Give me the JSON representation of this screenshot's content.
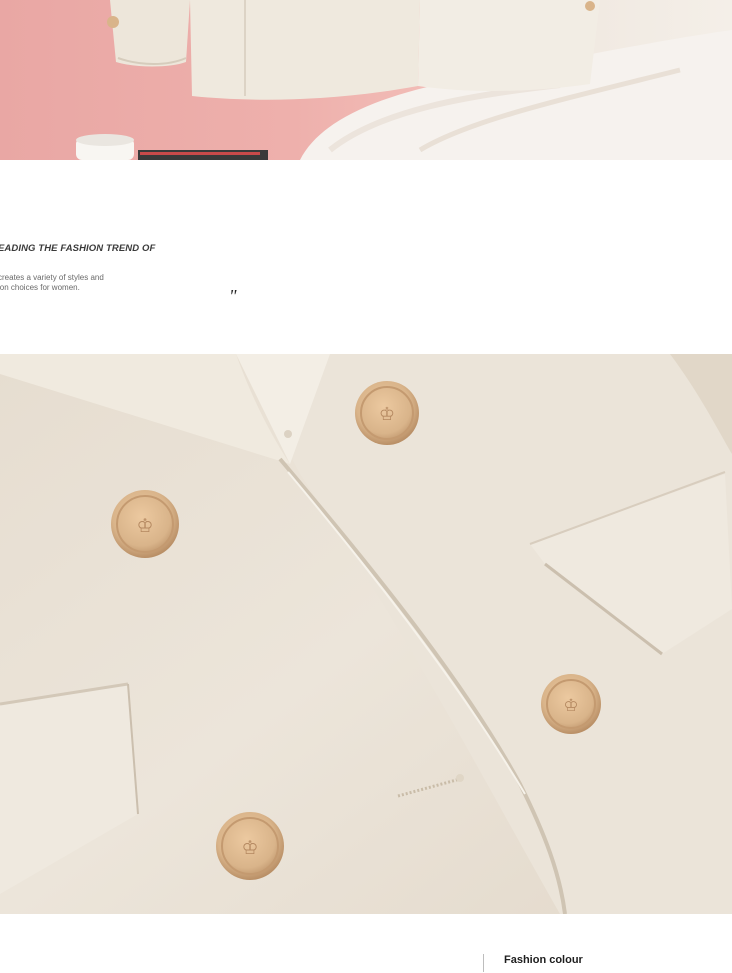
{
  "intro": {
    "heading": "EADING THE FASHION TREND OF",
    "desc_line1": "creates a variety of styles and",
    "desc_line2": "ion choices for women.",
    "quote_mark": "\""
  },
  "footer": {
    "section_title": "Fashion colour"
  },
  "colors": {
    "fabric": "#e9e1d5",
    "button_gold": "#d9b48a",
    "backdrop_pink": "#eeb0ac"
  }
}
